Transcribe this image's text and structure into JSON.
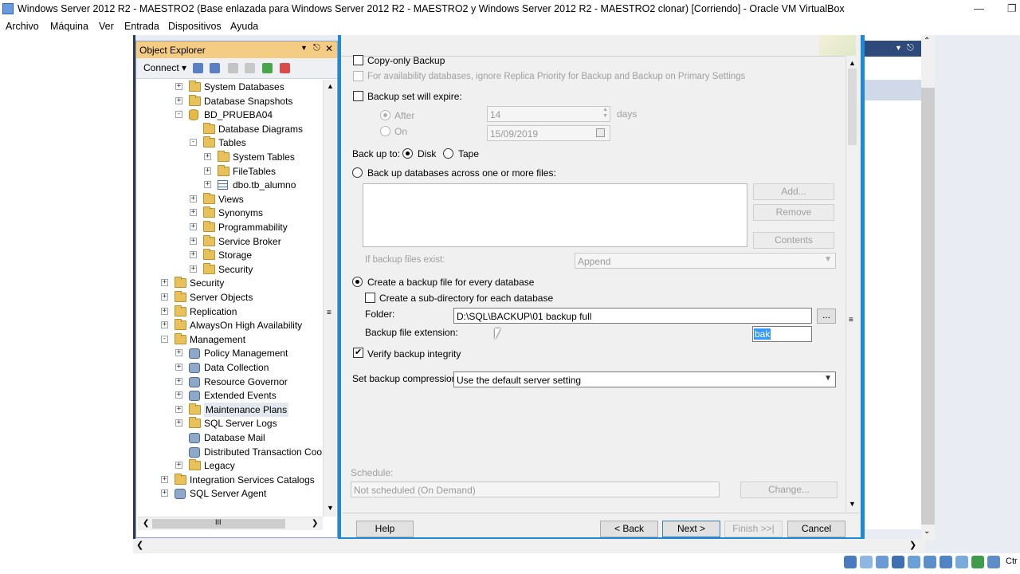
{
  "host": {
    "title": "Windows Server 2012 R2 - MAESTRO2 (Base enlazada para Windows Server 2012 R2 - MAESTRO2 y Windows Server 2012 R2 - MAESTRO2 clonar) [Corriendo] - Oracle VM VirtualBox",
    "menu": [
      "Archivo",
      "Máquina",
      "Ver",
      "Entrada",
      "Dispositivos",
      "Ayuda"
    ]
  },
  "object_explorer": {
    "title": "Object Explorer",
    "connect": "Connect",
    "tree": [
      {
        "label": "System Databases",
        "exp": "+",
        "icon": "folder"
      },
      {
        "label": "Database Snapshots",
        "exp": "+",
        "icon": "folder"
      },
      {
        "label": "BD_PRUEBA04",
        "exp": "−",
        "icon": "database"
      },
      {
        "label": "Database Diagrams",
        "exp": "",
        "icon": "folder"
      },
      {
        "label": "Tables",
        "exp": "−",
        "icon": "folder"
      },
      {
        "label": "System Tables",
        "exp": "+",
        "icon": "folder"
      },
      {
        "label": "FileTables",
        "exp": "+",
        "icon": "folder"
      },
      {
        "label": "dbo.tb_alumno",
        "exp": "+",
        "icon": "table"
      },
      {
        "label": "Views",
        "exp": "+",
        "icon": "folder"
      },
      {
        "label": "Synonyms",
        "exp": "+",
        "icon": "folder"
      },
      {
        "label": "Programmability",
        "exp": "+",
        "icon": "folder"
      },
      {
        "label": "Service Broker",
        "exp": "+",
        "icon": "folder"
      },
      {
        "label": "Storage",
        "exp": "+",
        "icon": "folder"
      },
      {
        "label": "Security",
        "exp": "+",
        "icon": "folder"
      },
      {
        "label": "Security",
        "exp": "+",
        "icon": "folder"
      },
      {
        "label": "Server Objects",
        "exp": "+",
        "icon": "folder"
      },
      {
        "label": "Replication",
        "exp": "+",
        "icon": "folder"
      },
      {
        "label": "AlwaysOn High Availability",
        "exp": "+",
        "icon": "folder"
      },
      {
        "label": "Management",
        "exp": "−",
        "icon": "folder"
      },
      {
        "label": "Policy Management",
        "exp": "+",
        "icon": "gear"
      },
      {
        "label": "Data Collection",
        "exp": "+",
        "icon": "gear"
      },
      {
        "label": "Resource Governor",
        "exp": "+",
        "icon": "gear"
      },
      {
        "label": "Extended Events",
        "exp": "+",
        "icon": "gear"
      },
      {
        "label": "Maintenance Plans",
        "exp": "+",
        "icon": "folder"
      },
      {
        "label": "SQL Server Logs",
        "exp": "+",
        "icon": "folder"
      },
      {
        "label": "Database Mail",
        "exp": "",
        "icon": "gear"
      },
      {
        "label": "Distributed Transaction Coor",
        "exp": "",
        "icon": "gear"
      },
      {
        "label": "Legacy",
        "exp": "+",
        "icon": "folder"
      },
      {
        "label": "Integration Services Catalogs",
        "exp": "+",
        "icon": "folder"
      },
      {
        "label": "SQL Server Agent",
        "exp": "+",
        "icon": "gear"
      }
    ]
  },
  "dialog": {
    "copy_only": "Copy-only Backup",
    "availability_note": "For availability databases, ignore Replica Priority for Backup and Backup on Primary Settings",
    "expire_label": "Backup set will expire:",
    "after_label": "After",
    "after_value": "14",
    "days_label": "days",
    "on_label": "On",
    "on_value": "15/09/2019",
    "backup_up_to": "Back up to:",
    "disk_label": "Disk",
    "tape_label": "Tape",
    "across_files": "Back up databases across one or more files:",
    "add_btn": "Add...",
    "remove_btn": "Remove",
    "contents_btn": "Contents",
    "if_exists_label": "If backup files exist:",
    "if_exists_value": "Append",
    "create_file_every_db": "Create a backup file for every database",
    "create_subdir": "Create a sub-directory for each database",
    "folder_label": "Folder:",
    "folder_value": "D:\\SQL\\BACKUP\\01 backup full",
    "browse_btn": "...",
    "ext_label": "Backup file extension:",
    "ext_value": "bak",
    "verify_label": "Verify backup integrity",
    "compression_label": "Set backup compression:",
    "compression_value": "Use the default server setting",
    "schedule_label": "Schedule:",
    "schedule_value": "Not scheduled (On Demand)",
    "change_btn": "Change...",
    "help_btn": "Help",
    "back_btn": "< Back",
    "next_btn": "Next >",
    "finish_btn": "Finish >>|",
    "cancel_btn": "Cancel"
  }
}
